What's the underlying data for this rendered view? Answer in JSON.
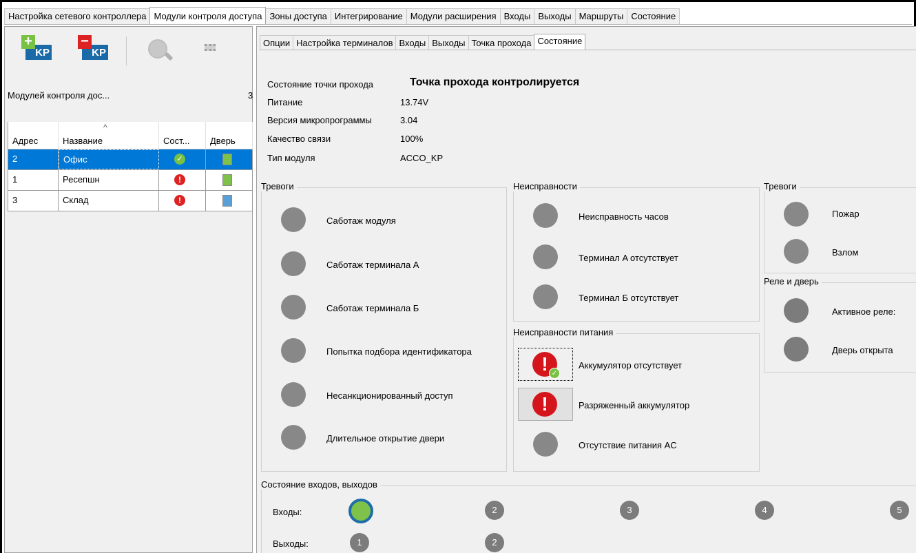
{
  "top_tabs": [
    {
      "label": "Настройка сетевого контроллера"
    },
    {
      "label": "Модули контроля доступа"
    },
    {
      "label": "Зоны доступа"
    },
    {
      "label": "Интегрирование"
    },
    {
      "label": "Модули расширения"
    },
    {
      "label": "Входы"
    },
    {
      "label": "Выходы"
    },
    {
      "label": "Маршруты"
    },
    {
      "label": "Состояние"
    }
  ],
  "toolbar": {
    "add_badge": "KP",
    "remove_badge": "KP",
    "add_icon": "plus-icon",
    "remove_icon": "minus-icon",
    "search_icon": "magnifier-icon",
    "chip_icon": "chip-icon"
  },
  "modules": {
    "label": "Модулей контроля дос...",
    "count": "3"
  },
  "grid": {
    "columns": [
      "Адрес",
      "Название",
      "Сост...",
      "Дверь"
    ],
    "rows": [
      {
        "address": "2",
        "name": "Офис",
        "status": "ok",
        "door": "closed"
      },
      {
        "address": "1",
        "name": "Ресепшн",
        "status": "error",
        "door": "closed"
      },
      {
        "address": "3",
        "name": "Склад",
        "status": "error",
        "door": "open"
      }
    ]
  },
  "sub_tabs": [
    {
      "label": "Опции"
    },
    {
      "label": "Настройка терминалов"
    },
    {
      "label": "Входы"
    },
    {
      "label": "Выходы"
    },
    {
      "label": "Точка прохода"
    },
    {
      "label": "Состояние"
    }
  ],
  "info": {
    "state_label": "Состояние точки прохода",
    "state_value": "Точка прохода контролируется",
    "power_label": "Питание",
    "power_value": "13.74V",
    "firmware_label": "Версия микропрограммы",
    "firmware_value": "3.04",
    "quality_label": "Качество связи",
    "quality_value": "100%",
    "type_label": "Тип модуля",
    "type_value": "ACCO_KP"
  },
  "alarms": {
    "title": "Тревоги",
    "items": [
      "Саботаж модуля",
      "Саботаж терминала A",
      "Саботаж терминала Б",
      "Попытка подбора идентификатора",
      "Несанкционированный доступ",
      "Длительное открытие двери"
    ]
  },
  "faults": {
    "title": "Неисправности",
    "items": [
      "Неисправность часов",
      "Терминал A отсутствует",
      "Терминал Б отсутствует"
    ]
  },
  "power_faults": {
    "title": "Неисправности питания",
    "items": [
      "Аккумулятор отсутствует",
      "Разряженный аккумулятор",
      "Отсутствие питания AC"
    ]
  },
  "alarms2": {
    "title": "Тревоги",
    "items": [
      "Пожар",
      "Взлом"
    ]
  },
  "relay": {
    "title": "Реле и дверь",
    "items": [
      "Активное реле:",
      "Дверь открыта"
    ]
  },
  "io": {
    "title": "Состояние входов, выходов",
    "inputs_label": "Входы:",
    "outputs_label": "Выходы:",
    "inputs": [
      "1",
      "2",
      "3",
      "4",
      "5"
    ],
    "outputs": [
      "1",
      "2"
    ]
  },
  "colors": {
    "accent": "#0078d7",
    "ok": "#79c143",
    "error": "#d4161c",
    "kp_blue": "#1a6aa7",
    "indicator_gray": "#888888"
  }
}
